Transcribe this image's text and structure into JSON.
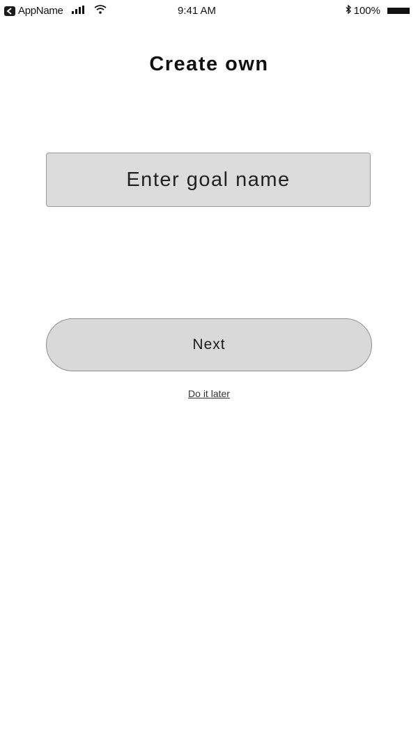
{
  "status_bar": {
    "app_name": "AppName",
    "time": "9:41 AM",
    "battery_percent": "100%",
    "icons": [
      "back-badge-icon",
      "signal-icon",
      "wifi-icon",
      "bluetooth-icon",
      "battery-icon"
    ]
  },
  "title": "Create own",
  "goal_input": {
    "placeholder": "Enter goal name",
    "value": ""
  },
  "next_button": {
    "label": "Next"
  },
  "later_link": {
    "label": "Do it later"
  }
}
